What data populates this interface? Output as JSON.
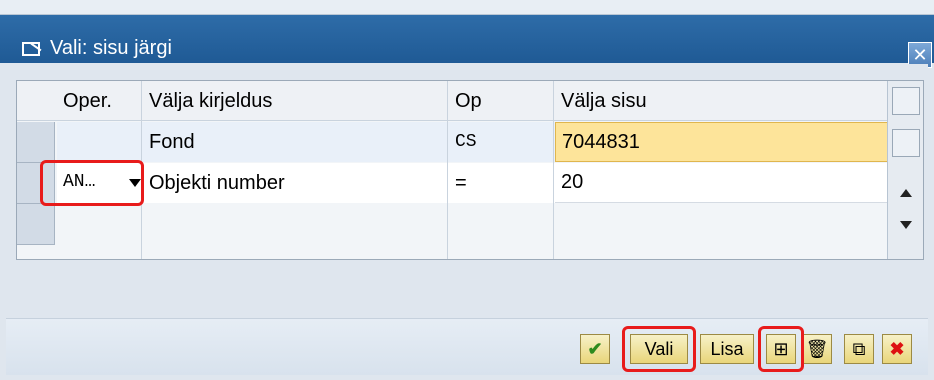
{
  "window": {
    "title": "Vali: sisu järgi",
    "close_icon": "close-icon"
  },
  "table": {
    "headers": {
      "oper": "Oper.",
      "desc": "Välja kirjeldus",
      "op": "Op",
      "value": "Välja sisu"
    },
    "rows": [
      {
        "oper": "",
        "desc": "Fond",
        "op": "CS",
        "value": "7044831"
      },
      {
        "oper": "AN…",
        "desc": "Objekti number",
        "op": "=",
        "value": "20"
      },
      {
        "oper": "",
        "desc": "",
        "op": "",
        "value": ""
      }
    ]
  },
  "buttons": {
    "confirm_icon": "check-icon",
    "vali": "Vali",
    "lisa": "Lisa",
    "add_line_icon": "add-line-icon",
    "delete_icon": "trash-icon",
    "layout_icon": "layout-icon",
    "cancel_icon": "x-icon"
  },
  "colors": {
    "title_bar": "#1f5a95",
    "highlight_input": "#fde49a",
    "annotation": "#e81b1b"
  }
}
